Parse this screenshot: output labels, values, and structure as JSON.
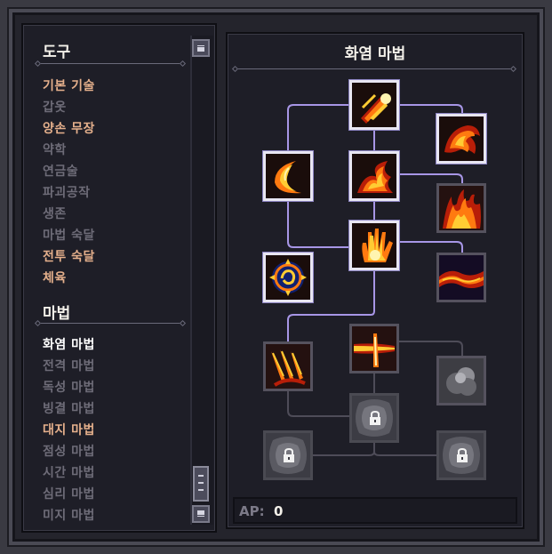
{
  "left_panel": {
    "heading_tools": "도구",
    "tools": [
      {
        "label": "기본 기술",
        "state": "active"
      },
      {
        "label": "갑옷",
        "state": "inactive"
      },
      {
        "label": "양손 무장",
        "state": "active"
      },
      {
        "label": "약학",
        "state": "inactive"
      },
      {
        "label": "연금술",
        "state": "inactive"
      },
      {
        "label": "파괴공작",
        "state": "inactive"
      },
      {
        "label": "생존",
        "state": "inactive"
      },
      {
        "label": "마법 숙달",
        "state": "inactive"
      },
      {
        "label": "전투 숙달",
        "state": "active"
      },
      {
        "label": "체육",
        "state": "active"
      }
    ],
    "heading_magic": "마법",
    "magic": [
      {
        "label": "화염 마법",
        "state": "selected"
      },
      {
        "label": "전격 마법",
        "state": "inactive"
      },
      {
        "label": "독성 마법",
        "state": "inactive"
      },
      {
        "label": "빙결 마법",
        "state": "inactive"
      },
      {
        "label": "대지 마법",
        "state": "active"
      },
      {
        "label": "점성 마법",
        "state": "inactive"
      },
      {
        "label": "시간 마법",
        "state": "inactive"
      },
      {
        "label": "심리 마법",
        "state": "inactive"
      },
      {
        "label": "미지 마법",
        "state": "inactive"
      }
    ]
  },
  "tree": {
    "title": "화염 마법",
    "nodes": [
      {
        "icon": "fire-comet-icon",
        "state": "unlocked"
      },
      {
        "icon": "fire-dragon-icon",
        "state": "unlocked"
      },
      {
        "icon": "fire-crescent-icon",
        "state": "unlocked"
      },
      {
        "icon": "fire-burst-icon",
        "state": "unlocked"
      },
      {
        "icon": "fire-wall-icon",
        "state": "available"
      },
      {
        "icon": "fire-hand-icon",
        "state": "unlocked"
      },
      {
        "icon": "fire-seal-icon",
        "state": "unlocked"
      },
      {
        "icon": "fire-ground-icon",
        "state": "available"
      },
      {
        "icon": "fire-claw-icon",
        "state": "available"
      },
      {
        "icon": "fire-beam-icon",
        "state": "available"
      },
      {
        "icon": "smoke-icon",
        "state": "unavailable"
      },
      {
        "icon": "lock-icon",
        "state": "locked"
      },
      {
        "icon": "lock-icon",
        "state": "locked"
      },
      {
        "icon": "lock-icon",
        "state": "locked"
      }
    ]
  },
  "ap": {
    "label": "AP:",
    "value": "0"
  },
  "colors": {
    "active_text": "#e5b08c",
    "inactive_text": "#6e6c78",
    "selected_text": "#ffffff",
    "connector": "#a796e6",
    "connector_dim": "#4e4c58"
  }
}
